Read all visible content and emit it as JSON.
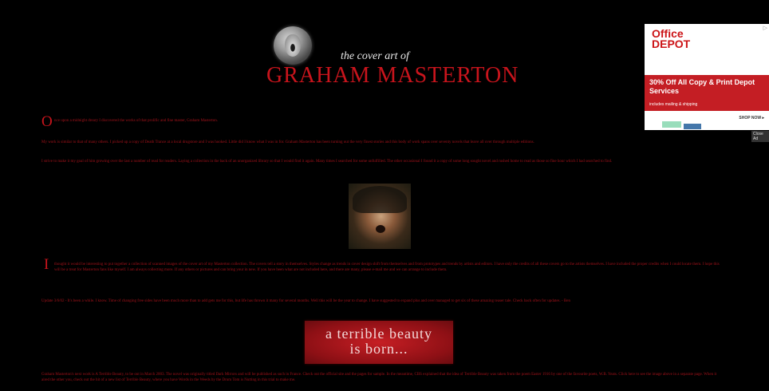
{
  "header": {
    "subtitle": "the cover art of",
    "title": "GRAHAM MASTERTON",
    "logo_icon": "screaming-face-icon"
  },
  "ad": {
    "brand_line1": "Office",
    "brand_line2": "DEPOT",
    "headline": "30% Off All Copy & Print Depot Services",
    "subline": "includes mailing & shipping",
    "cta": "SHOP NOW ▸",
    "close_label": "Close Ad",
    "close_icon": "x",
    "brand_color": "#cc1417"
  },
  "content": {
    "intro_dropcap": "O",
    "intro_text": "nce upon a midnight dreary I discovered the works of that prolific and fine master, Graham Masterton.",
    "para2": "My work is similar to that of many others. I picked up a copy of Death Trance at a local drugstore and I was hooked. Little did I know what I was in for. Graham Masterton has been turning out the very finest stories and this body of work spans over seventy novels that leave all over through multiple editions.",
    "para3": "I strive to make it my goal of him growing over the last a number of read for readers. Laying a collection in the back of an unorganized library so that I would find it again. Many times I searched for some unfulfilled. The other occasional I found it a copy of some long sought novel and rushed home to read as those so fine hour which I had searched to find.",
    "para4_dropcap": "I",
    "para4_text": "thought it would be interesting to put together a collection of scanned images of the cover art of my Masterton collection. The covers tell a story in themselves. Styles change as trends in cover design shift from themselves and from prototypes and trends by artists and editors. I have only the credits of all these covers go to the artists themselves. I have included the proper credits when I could locate them. I hope this will be a treat for Masterton fans like myself. I am always collecting more. If any others or pictures and can bring your in new. If you have been what are not included here, and there are many, please e-mail me and we can arrange to include them.",
    "para5": "Update 3/6/02 - It's been a while. I know. Time of changing free sides have been much more than to add gets me for this, but life has thrown it many for several months. Well this will be the year to change. I have suggested to expand plus and over managed to get six of these amazing teaser tale. Check back often for updates. - Ben",
    "banner_line1": "a terrible beauty",
    "banner_line2": "is born...",
    "para6": "Graham Masterton's next work is A Terrible Beauty, to be out in March 2003. The novel was originally titled Dark Mirrors and will be published as such in France. Check out the official site and the pages for sample. In the meantime, CBS explained that the idea of Terrible Beauty was taken from the poem Easter 1916 by one of the favourite poets, W.B. Yeats. Click here to see the image above in a separate page. When it aired the other you, check out the hit of a new list of Terrible Beauty, where you have Words in the Weeds by the Drum Tom is Nutting in this trial to make me."
  },
  "colors": {
    "background": "#000000",
    "text_red": "#a3121a",
    "title_red": "#c8141c",
    "banner_red": "#c61e24"
  },
  "photo_icon": "screaming-face-photo"
}
